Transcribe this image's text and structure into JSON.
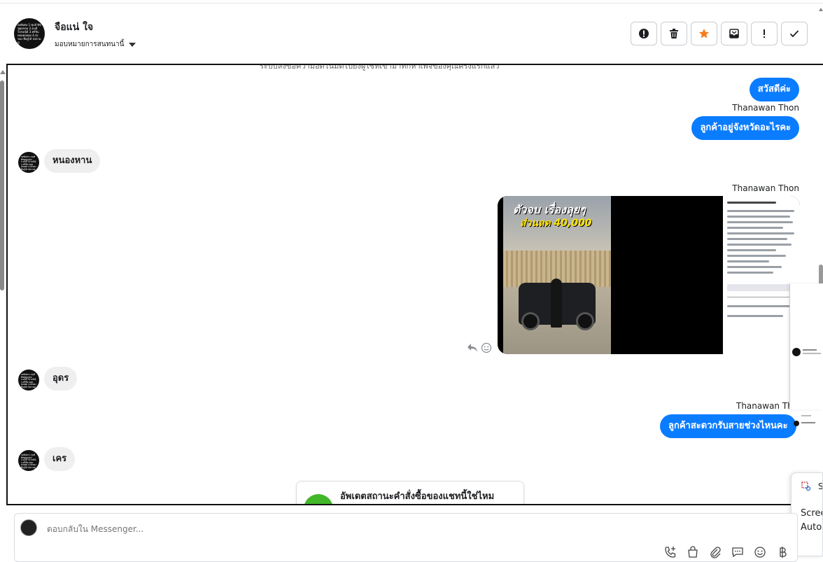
{
  "header": {
    "contact_name": "จือแน่ ใจ",
    "assign_label": "มอบหมายการสนทนานี้",
    "avatar_text": "ลดพิเศษ 1.ซุปส์ พิซซูคุยกตม 2.ดนมี ไปรษณีย์ 3.ฟรีสิน ทอดต่อยอด 4.ส่งของ ที่อยู่ได้ ส่งตามดู"
  },
  "toolbar": {
    "buttons": [
      {
        "name": "spam-alert-button",
        "icon": "alert-circle-icon"
      },
      {
        "name": "delete-button",
        "icon": "trash-icon"
      },
      {
        "name": "star-button",
        "icon": "star-icon",
        "color": "#f57c1f"
      },
      {
        "name": "archive-button",
        "icon": "mail-box-icon"
      },
      {
        "name": "important-button",
        "icon": "exclamation-icon"
      },
      {
        "name": "done-button",
        "icon": "check-icon"
      }
    ]
  },
  "conversation": {
    "cut_text": "ระบบส่งข้อความอัตโนมัติไปยังผู้ใช้ที่เข้ามาทักหาเพจของคุณครั้งแรกแล้ว",
    "messages": [
      {
        "type": "outgoing",
        "text": "สวัสดีค่ะ"
      },
      {
        "type": "sender",
        "text": "Thanawan Thon"
      },
      {
        "type": "outgoing",
        "text": "ลูกค้าอยู่จังหวัดอะไรคะ"
      },
      {
        "type": "incoming",
        "text": "หนองหาน"
      },
      {
        "type": "sender",
        "text": "Thanawan Thon"
      },
      {
        "type": "image",
        "headline": "ตัวจบ เรื่องลุยๆ",
        "discount": "ส่วนลด 40,000"
      },
      {
        "type": "incoming",
        "text": "อุดร"
      },
      {
        "type": "sender",
        "text": "Thanawan Tho"
      },
      {
        "type": "outgoing",
        "text": "ลูกค้าสะดวกรับสายช่วงไหนคะ"
      },
      {
        "type": "incoming",
        "text": "เคร"
      }
    ]
  },
  "order_prompt": {
    "text": "อัพเดตสถานะคำสั่งซื้อของแชทนี้ใช่ไหม"
  },
  "composer": {
    "placeholder": "ตอบกลับใน Messenger...",
    "icons": [
      "phone-plus-icon",
      "shopping-bag-icon",
      "attachment-icon",
      "saved-reply-icon",
      "emoji-icon",
      "baht-icon"
    ]
  },
  "side_popup": {
    "title_partial": "Sc",
    "line1": "Scree",
    "line2": "Autor"
  }
}
